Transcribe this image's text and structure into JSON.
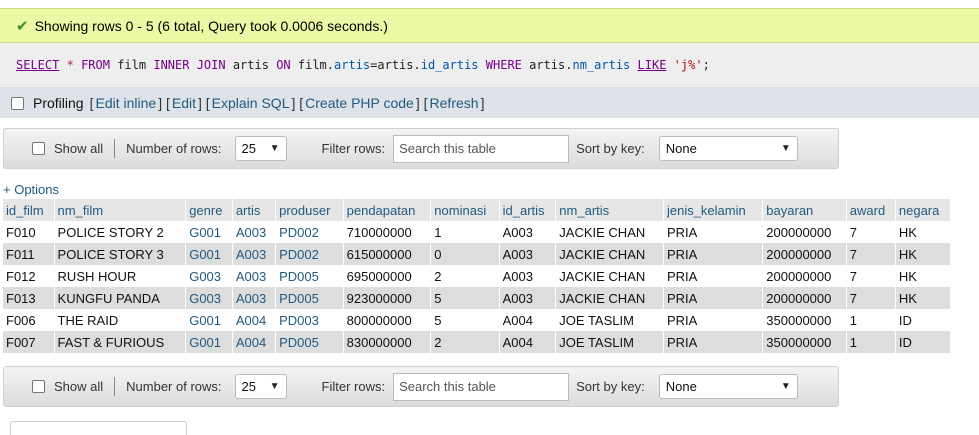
{
  "status": {
    "message": "Showing rows 0 - 5 (6 total, Query took 0.0006 seconds.)",
    "check_icon": "check-icon",
    "colors": {
      "background": "#ebf8a4",
      "check": "#3a8f2b"
    }
  },
  "sql": {
    "t1": "SELECT",
    "t2": "*",
    "t3": "FROM",
    "t4": "film",
    "t5": "INNER JOIN",
    "t6": "artis",
    "t7": "ON",
    "t8": "film",
    "t9": ".",
    "t10": "artis",
    "t11": "=",
    "t12": "artis",
    "t13": ".",
    "t14": "id_artis",
    "t15": "WHERE",
    "t16": "artis",
    "t17": ".",
    "t18": "nm_artis",
    "t19": "LIKE",
    "t20": "'j%'",
    "t21": ";"
  },
  "profiling": {
    "label": "Profiling",
    "links": [
      "Edit inline",
      "Edit",
      "Explain SQL",
      "Create PHP code",
      "Refresh"
    ]
  },
  "nav": {
    "show_all": "Show all",
    "rows_label": "Number of rows:",
    "rows_value": "25",
    "filter_label": "Filter rows:",
    "filter_placeholder": "Search this table",
    "sort_label": "Sort by key:",
    "sort_value": "None"
  },
  "options_link": "+ Options",
  "table": {
    "headers": [
      "id_film",
      "nm_film",
      "genre",
      "artis",
      "produser",
      "pendapatan",
      "nominasi",
      "id_artis",
      "nm_artis",
      "jenis_kelamin",
      "bayaran",
      "award",
      "negara"
    ],
    "rows": [
      [
        "F010",
        "POLICE STORY 2",
        "G001",
        "A003",
        "PD002",
        "710000000",
        "1",
        "A003",
        "JACKIE CHAN",
        "PRIA",
        "200000000",
        "7",
        "HK"
      ],
      [
        "F011",
        "POLICE STORY 3",
        "G001",
        "A003",
        "PD002",
        "615000000",
        "0",
        "A003",
        "JACKIE CHAN",
        "PRIA",
        "200000000",
        "7",
        "HK"
      ],
      [
        "F012",
        "RUSH HOUR",
        "G003",
        "A003",
        "PD005",
        "695000000",
        "2",
        "A003",
        "JACKIE CHAN",
        "PRIA",
        "200000000",
        "7",
        "HK"
      ],
      [
        "F013",
        "KUNGFU PANDA",
        "G003",
        "A003",
        "PD005",
        "923000000",
        "5",
        "A003",
        "JACKIE CHAN",
        "PRIA",
        "200000000",
        "7",
        "HK"
      ],
      [
        "F006",
        "THE RAID",
        "G001",
        "A004",
        "PD003",
        "800000000",
        "5",
        "A004",
        "JOE TASLIM",
        "PRIA",
        "350000000",
        "1",
        "ID"
      ],
      [
        "F007",
        "FAST & FURIOUS",
        "G001",
        "A004",
        "PD005",
        "830000000",
        "2",
        "A004",
        "JOE TASLIM",
        "PRIA",
        "350000000",
        "1",
        "ID"
      ]
    ]
  }
}
